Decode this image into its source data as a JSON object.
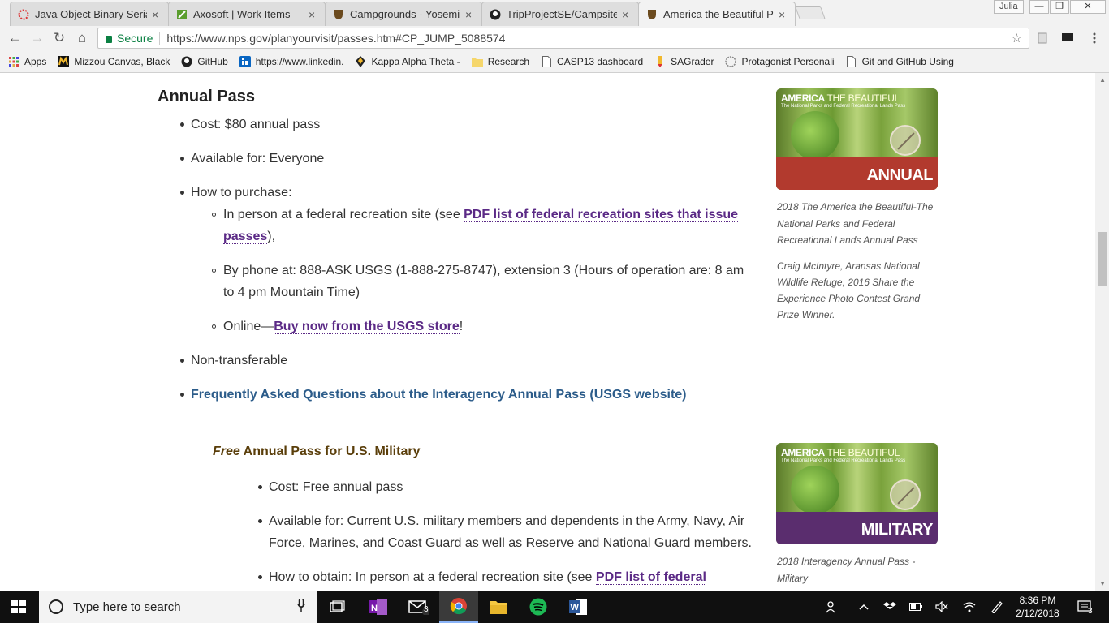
{
  "browser": {
    "tabs": [
      {
        "title": "Java Object Binary Serializ",
        "icon": "java-circle-icon",
        "close": "×"
      },
      {
        "title": "Axosoft | Work Items",
        "icon": "axosoft-icon",
        "close": "×"
      },
      {
        "title": "Campgrounds - Yosemite",
        "icon": "nps-arrowhead-icon",
        "close": "×"
      },
      {
        "title": "TripProjectSE/CampsiteD",
        "icon": "github-icon",
        "close": "×"
      },
      {
        "title": "America the Beautiful Pa",
        "icon": "nps-arrowhead-icon",
        "close": "×"
      }
    ],
    "profile_name": "Julia",
    "window_buttons": [
      "—",
      "❐",
      "✕"
    ],
    "nav": {
      "back": "←",
      "forward": "→",
      "reload": "↻",
      "home": "⌂"
    },
    "address": {
      "secure_label": "Secure",
      "url": "https://www.nps.gov/planyourvisit/passes.htm#CP_JUMP_5088574",
      "star": "☆"
    },
    "bookmarks": [
      {
        "label": "Apps",
        "icon": "apps-grid-icon"
      },
      {
        "label": "Mizzou Canvas, Black",
        "icon": "mizzou-icon"
      },
      {
        "label": "GitHub",
        "icon": "github-icon"
      },
      {
        "label": "https://www.linkedin.",
        "icon": "linkedin-icon"
      },
      {
        "label": "Kappa Alpha Theta -",
        "icon": "kite-icon"
      },
      {
        "label": "Research",
        "icon": "folder-icon"
      },
      {
        "label": "CASP13 dashboard",
        "icon": "page-icon"
      },
      {
        "label": "SAGrader",
        "icon": "pencil-icon"
      },
      {
        "label": "Protagonist Personali",
        "icon": "globe-icon"
      },
      {
        "label": "Git and GitHub Using",
        "icon": "page-icon"
      }
    ]
  },
  "page": {
    "annual_heading": "Annual Pass",
    "annual_items": {
      "cost": "Cost: $80 annual pass",
      "available": "Available for: Everyone",
      "how": "How to purchase:",
      "inperson_pre": "In person at a federal recreation site (see ",
      "inperson_link1": "PDF list of federal recreation sites that issue",
      "inperson_link2": "passes",
      "inperson_post": "),",
      "phone_line1": "By phone at: 888-ASK USGS (1-888-275-8747), extension 3 (Hours of operation are: 8 am",
      "phone_line2": "to 4 pm Mountain Time)",
      "online_pre": "Online—",
      "online_link": "Buy now from the USGS store",
      "online_post": "!",
      "nontransferable": "Non-transferable",
      "faq_link": "Frequently Asked Questions about the Interagency Annual Pass (USGS website)"
    },
    "annual_card": {
      "brand": "AMERICA",
      "brand_rest": "THE BEAUTIFUL",
      "subtitle": "The National Parks and Federal Recreational Lands Pass",
      "band_label": "ANNUAL",
      "band_color": "#b23a2e"
    },
    "annual_caption": [
      "2018 The America the Beautiful-The",
      "National Parks and Federal",
      "Recreational Lands Annual Pass"
    ],
    "annual_credit": [
      "Craig McIntyre, Aransas National",
      "Wildlife Refuge, 2016 Share the",
      "Experience Photo Contest Grand",
      "Prize Winner."
    ],
    "military_heading_em": "Free",
    "military_heading_rest": " Annual Pass for U.S. Military",
    "military_items": {
      "cost": "Cost: Free annual pass",
      "available_line1": "Available for: Current U.S. military members and dependents in the Army, Navy, Air",
      "available_line2": "Force, Marines, and Coast Guard as well as Reserve and National Guard members.",
      "how_pre": "How to obtain: In person at a federal recreation site (see ",
      "how_link": "PDF list of federal"
    },
    "military_card": {
      "brand": "AMERICA",
      "brand_rest": "THE BEAUTIFUL",
      "subtitle": "The National Parks and Federal Recreational Lands Pass",
      "band_label": "MILITARY",
      "band_color": "#5a2d6e"
    },
    "military_caption": [
      "2018 Interagency Annual Pass -",
      "Military"
    ]
  },
  "taskbar": {
    "search_placeholder": "Type here to search",
    "apps": [
      "task-view-icon",
      "onenote-icon",
      "mail-icon",
      "chrome-icon",
      "file-explorer-icon",
      "spotify-icon",
      "word-icon"
    ],
    "mail_badge": "3",
    "time": "8:36 PM",
    "date": "2/12/2018",
    "notif_badge": "3"
  }
}
